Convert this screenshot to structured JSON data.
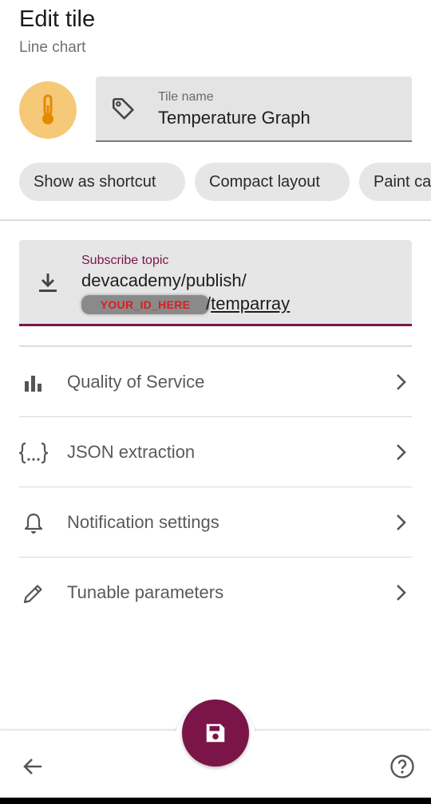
{
  "header": {
    "title": "Edit tile",
    "subtitle": "Line chart"
  },
  "tile_name": {
    "label": "Tile name",
    "value": "Temperature Graph"
  },
  "chips": [
    "Show as shortcut",
    "Compact layout",
    "Paint ca"
  ],
  "subscribe": {
    "label": "Subscribe topic",
    "line1": "devacademy/publish/",
    "redacted_placeholder": "YOUR_ID_HERE",
    "suffix_sep": "/",
    "suffix_link": "temparray"
  },
  "settings": [
    {
      "label": "Quality of Service",
      "icon": "bar-chart-icon"
    },
    {
      "label": "JSON extraction",
      "icon": "braces-icon"
    },
    {
      "label": "Notification settings",
      "icon": "bell-icon"
    },
    {
      "label": "Tunable parameters",
      "icon": "pencil-icon"
    }
  ],
  "colors": {
    "accent": "#7b1548",
    "icon_bg": "#f6c978",
    "icon_fg": "#e58a00"
  }
}
